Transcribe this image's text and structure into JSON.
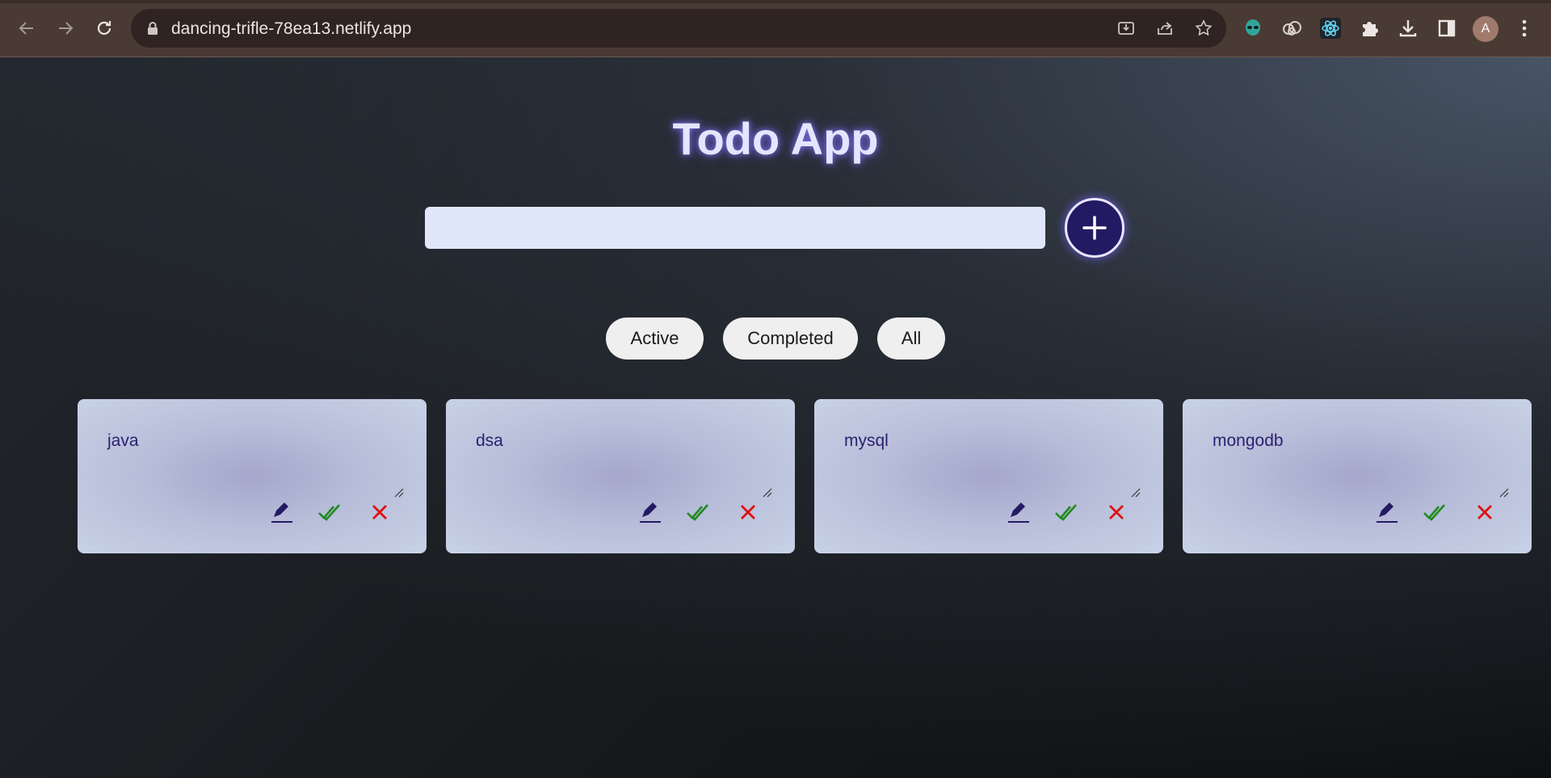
{
  "browser": {
    "url": "dancing-trifle-78ea13.netlify.app",
    "profile_initial": "A"
  },
  "app": {
    "title": "Todo App",
    "input_value": "",
    "add_symbol": "+"
  },
  "filters": [
    {
      "label": "Active"
    },
    {
      "label": "Completed"
    },
    {
      "label": "All"
    }
  ],
  "todos": [
    {
      "text": "java"
    },
    {
      "text": "dsa"
    },
    {
      "text": "mysql"
    },
    {
      "text": "mongodb"
    }
  ],
  "colors": {
    "edit": "#241a63",
    "complete": "#1f8a1f",
    "delete": "#e01010"
  }
}
